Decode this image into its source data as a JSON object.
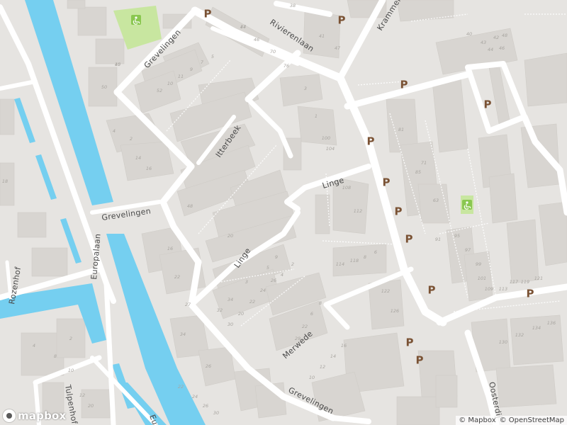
{
  "streets": {
    "grevelingen_north": "Grevelingen",
    "grevelingen_west": "Grevelingen",
    "grevelingen_south": "Grevelingen",
    "rivierenlaan": "Rivierenlaan",
    "krammer": "Krammer",
    "itterbeek": "Itterbeek",
    "linge_east": "Linge",
    "linge_west": "Linge",
    "europalaan": "Europalaan",
    "europalaan_south": "Eur",
    "rozenhof": "Rozenhof",
    "merwede": "Merwede",
    "tulpenhof": "Tulpenhof",
    "oosterdijk": "Oosterdij"
  },
  "parking_label": "P",
  "house_numbers": [
    "40",
    "44",
    "46",
    "70",
    "76",
    "38",
    "41",
    "47",
    "40",
    "43",
    "42",
    "44",
    "46",
    "48",
    "50",
    "52",
    "10",
    "11",
    "9",
    "7",
    "5",
    "3",
    "1",
    "100",
    "104",
    "108",
    "112",
    "114",
    "118",
    "8",
    "6",
    "4",
    "2",
    "14",
    "16",
    "18",
    "20",
    "48",
    "16",
    "22",
    "27",
    "34",
    "26",
    "30",
    "20",
    "22",
    "24",
    "26",
    "29",
    "22",
    "6",
    "8",
    "4",
    "2",
    "10",
    "12",
    "14",
    "16",
    "122",
    "126",
    "81",
    "85",
    "63",
    "71",
    "91",
    "95",
    "97",
    "99",
    "101",
    "109",
    "113",
    "117",
    "119",
    "121",
    "130",
    "132",
    "134",
    "136",
    "4",
    "2",
    "8",
    "10",
    "12",
    "20",
    "22",
    "24",
    "26",
    "30",
    "32",
    "34",
    "3",
    "5",
    "9",
    "15",
    "17"
  ],
  "attribution": {
    "mapbox": "© Mapbox",
    "osm": "© OpenStreetMap"
  },
  "logo_text": "mapbox",
  "colors": {
    "land": "#e6e4e1",
    "water": "#75cff0",
    "road": "#ffffff",
    "building": "#d8d5d1",
    "park": "#c8e6a0",
    "parking_label": "#7a5234"
  }
}
